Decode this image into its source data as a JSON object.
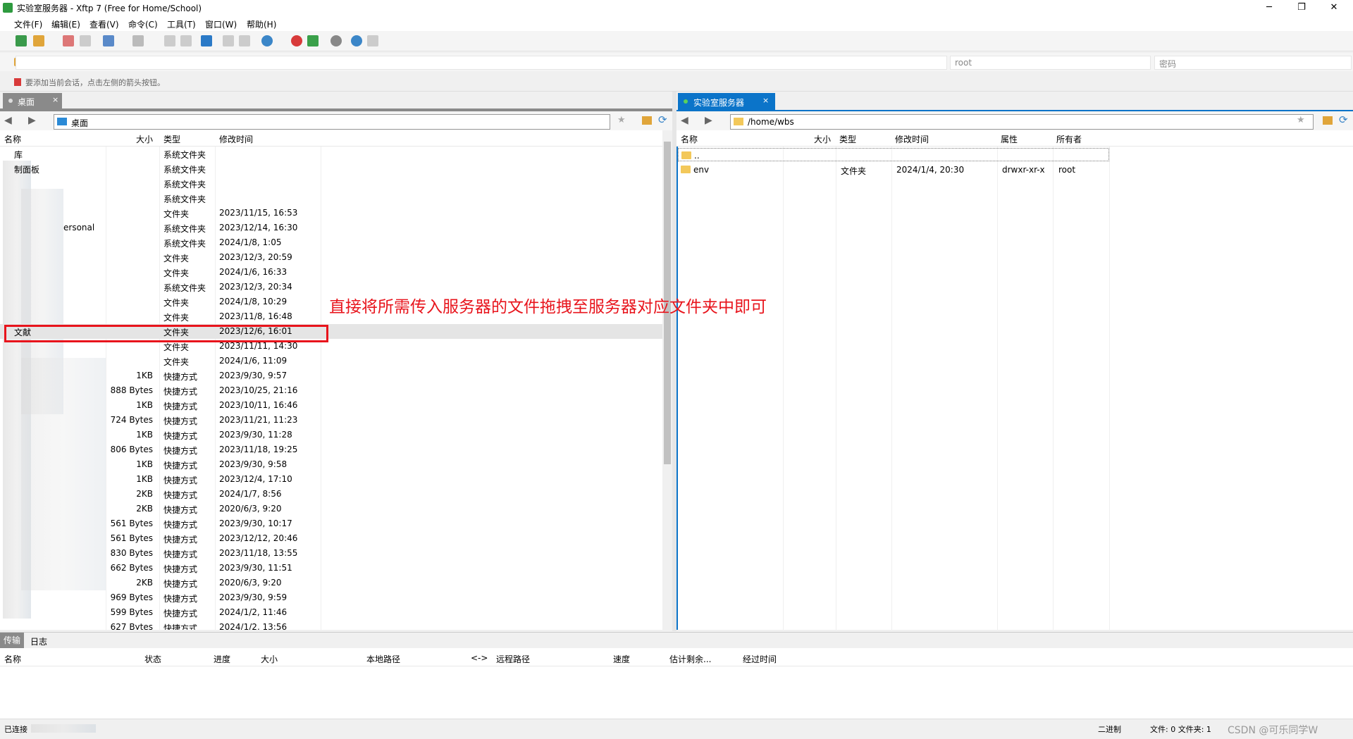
{
  "window": {
    "title": "实验室服务器 - Xftp 7 (Free for Home/School)",
    "controls": [
      "─",
      "❐",
      "✕"
    ]
  },
  "menu": [
    "文件(F)",
    "编辑(E)",
    "查看(V)",
    "命令(C)",
    "工具(T)",
    "窗口(W)",
    "帮助(H)"
  ],
  "address": {
    "user_placeholder": "root",
    "password_placeholder": "密码"
  },
  "hint": "要添加当前会话，点击左侧的箭头按钮。",
  "left_pane": {
    "tab": "桌面",
    "tab_close": "×",
    "path": "桌面",
    "columns": [
      "名称",
      "大小",
      "类型",
      "修改时间"
    ],
    "rows": [
      {
        "name": "库",
        "size": "",
        "type": "系统文件夹",
        "modified": ""
      },
      {
        "name": "制面板",
        "size": "",
        "type": "系统文件夹",
        "modified": ""
      },
      {
        "name": "",
        "size": "",
        "type": "系统文件夹",
        "modified": ""
      },
      {
        "name": "",
        "size": "",
        "type": "系统文件夹",
        "modified": ""
      },
      {
        "name": "",
        "size": "",
        "type": "文件夹",
        "modified": "2023/11/15, 16:53"
      },
      {
        "name": "ersonal",
        "size": "",
        "type": "系统文件夹",
        "modified": "2023/12/14, 16:30"
      },
      {
        "name": "",
        "size": "",
        "type": "系统文件夹",
        "modified": "2024/1/8, 1:05"
      },
      {
        "name": "",
        "size": "",
        "type": "文件夹",
        "modified": "2023/12/3, 20:59"
      },
      {
        "name": "",
        "size": "",
        "type": "文件夹",
        "modified": "2024/1/6, 16:33"
      },
      {
        "name": "",
        "size": "",
        "type": "系统文件夹",
        "modified": "2023/12/3, 20:34"
      },
      {
        "name": "",
        "size": "",
        "type": "文件夹",
        "modified": "2024/1/8, 10:29"
      },
      {
        "name": "",
        "size": "",
        "type": "文件夹",
        "modified": "2023/11/8, 16:48"
      },
      {
        "name": "文献",
        "size": "",
        "type": "文件夹",
        "modified": "2023/12/6, 16:01"
      },
      {
        "name": "",
        "size": "",
        "type": "文件夹",
        "modified": "2023/11/11, 14:30"
      },
      {
        "name": "",
        "size": "",
        "type": "文件夹",
        "modified": "2024/1/6, 11:09"
      },
      {
        "name": "",
        "size": "1KB",
        "type": "快捷方式",
        "modified": "2023/9/30, 9:57"
      },
      {
        "name": "",
        "size": "888 Bytes",
        "type": "快捷方式",
        "modified": "2023/10/25, 21:16"
      },
      {
        "name": "",
        "size": "1KB",
        "type": "快捷方式",
        "modified": "2023/10/11, 16:46"
      },
      {
        "name": "",
        "size": "724 Bytes",
        "type": "快捷方式",
        "modified": "2023/11/21, 11:23"
      },
      {
        "name": "",
        "size": "1KB",
        "type": "快捷方式",
        "modified": "2023/9/30, 11:28"
      },
      {
        "name": "",
        "size": "806 Bytes",
        "type": "快捷方式",
        "modified": "2023/11/18, 19:25"
      },
      {
        "name": "",
        "size": "1KB",
        "type": "快捷方式",
        "modified": "2023/9/30, 9:58"
      },
      {
        "name": "",
        "size": "1KB",
        "type": "快捷方式",
        "modified": "2023/12/4, 17:10"
      },
      {
        "name": "",
        "size": "2KB",
        "type": "快捷方式",
        "modified": "2024/1/7, 8:56"
      },
      {
        "name": "",
        "size": "2KB",
        "type": "快捷方式",
        "modified": "2020/6/3, 9:20"
      },
      {
        "name": "",
        "size": "561 Bytes",
        "type": "快捷方式",
        "modified": "2023/9/30, 10:17"
      },
      {
        "name": "",
        "size": "561 Bytes",
        "type": "快捷方式",
        "modified": "2023/12/12, 20:46"
      },
      {
        "name": "",
        "size": "830 Bytes",
        "type": "快捷方式",
        "modified": "2023/11/18, 13:55"
      },
      {
        "name": "",
        "size": "662 Bytes",
        "type": "快捷方式",
        "modified": "2023/9/30, 11:51"
      },
      {
        "name": "",
        "size": "2KB",
        "type": "快捷方式",
        "modified": "2020/6/3, 9:20"
      },
      {
        "name": "",
        "size": "969 Bytes",
        "type": "快捷方式",
        "modified": "2023/9/30, 9:59"
      },
      {
        "name": "",
        "size": "599 Bytes",
        "type": "快捷方式",
        "modified": "2024/1/2, 11:46"
      },
      {
        "name": "",
        "size": "627 Bytes",
        "type": "快捷方式",
        "modified": "2024/1/2, 13:56"
      }
    ]
  },
  "right_pane": {
    "tab": "实验室服务器",
    "tab_close": "×",
    "path": "/home/wbs",
    "columns": [
      "名称",
      "大小",
      "类型",
      "修改时间",
      "属性",
      "所有者"
    ],
    "rows": [
      {
        "name": "..",
        "size": "",
        "type": "",
        "modified": "",
        "attr": "",
        "owner": ""
      },
      {
        "name": "env",
        "size": "",
        "type": "文件夹",
        "modified": "2024/1/4, 20:30",
        "attr": "drwxr-xr-x",
        "owner": "root"
      }
    ]
  },
  "annotation": "直接将所需传入服务器的文件拖拽至服务器对应文件夹中即可",
  "transfer": {
    "tabs": [
      "传输",
      "日志"
    ],
    "columns": [
      "名称",
      "状态",
      "进度",
      "大小",
      "本地路径",
      "<->",
      "远程路径",
      "速度",
      "估计剩余...",
      "经过时间"
    ]
  },
  "status": {
    "connection": "已连接",
    "mode": "二进制",
    "counts": "文件: 0  文件夹: 1",
    "watermark": "CSDN @可乐同学W"
  },
  "colors": {
    "accent": "#0b74c9",
    "highlight_box": "#e8141c"
  }
}
